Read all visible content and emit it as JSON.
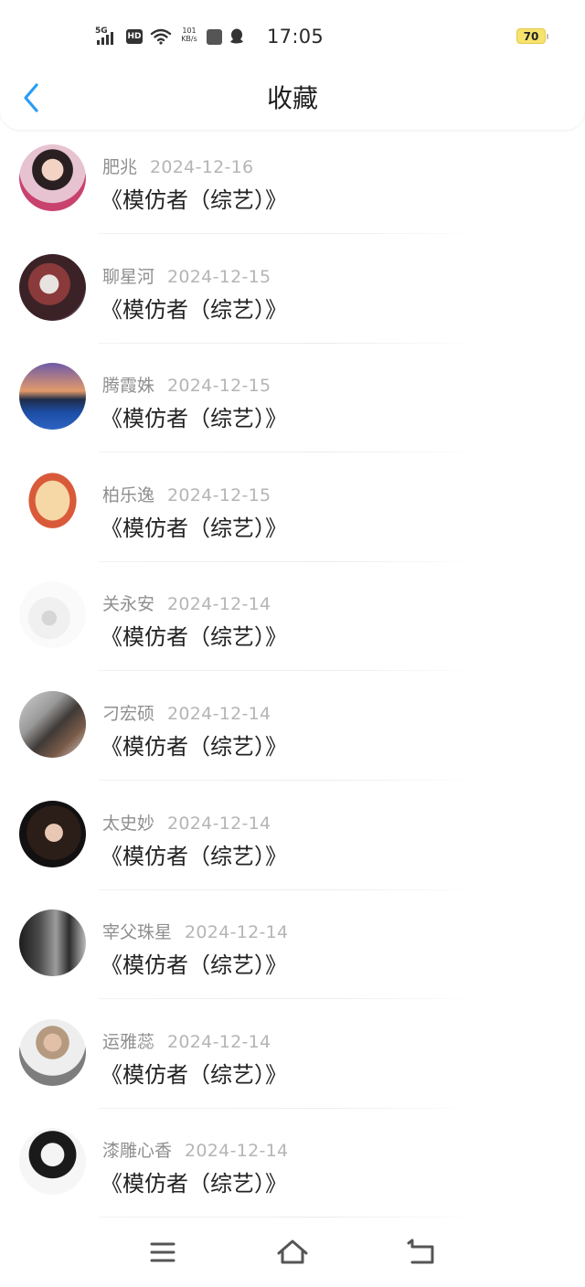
{
  "status_bar": {
    "network": "5G",
    "hd": "HD",
    "speed_value": "101",
    "speed_unit": "KB/s",
    "time": "17:05",
    "battery": "70"
  },
  "header": {
    "title": "收藏"
  },
  "items": [
    {
      "name": "肥兆",
      "date": "2024-12-16",
      "work": "《模仿者（综艺）》"
    },
    {
      "name": "聊星河",
      "date": "2024-12-15",
      "work": "《模仿者（综艺）》"
    },
    {
      "name": "腾霞姝",
      "date": "2024-12-15",
      "work": "《模仿者（综艺）》"
    },
    {
      "name": "柏乐逸",
      "date": "2024-12-15",
      "work": "《模仿者（综艺）》"
    },
    {
      "name": "关永安",
      "date": "2024-12-14",
      "work": "《模仿者（综艺）》"
    },
    {
      "name": "刁宏硕",
      "date": "2024-12-14",
      "work": "《模仿者（综艺）》"
    },
    {
      "name": "太史妙",
      "date": "2024-12-14",
      "work": "《模仿者（综艺）》"
    },
    {
      "name": "宰父珠星",
      "date": "2024-12-14",
      "work": "《模仿者（综艺）》"
    },
    {
      "name": "运雅蕊",
      "date": "2024-12-14",
      "work": "《模仿者（综艺）》"
    },
    {
      "name": "漆雕心香",
      "date": "2024-12-14",
      "work": "《模仿者（综艺）》"
    }
  ],
  "colors": {
    "accent": "#2a9df4",
    "battery": "#f7e36c"
  }
}
